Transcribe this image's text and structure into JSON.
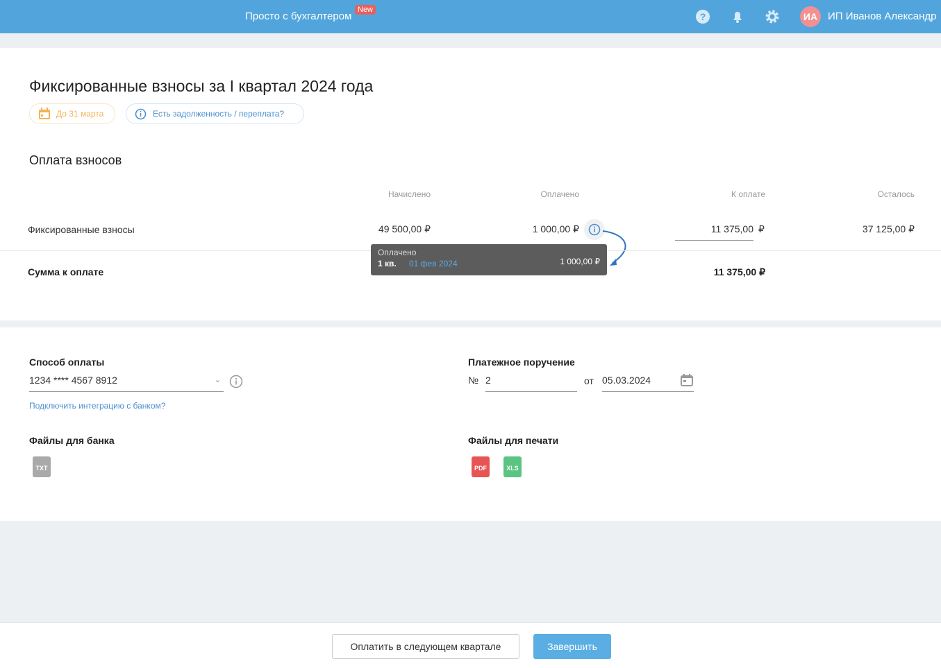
{
  "header": {
    "brand": "Просто с бухгалтером",
    "new_badge": "New",
    "avatar_initials": "ИА",
    "user_name": "ИП Иванов Александр"
  },
  "page": {
    "title": "Фиксированные взносы за I квартал 2024 года",
    "deadline": "До 31 марта",
    "debt_link": "Есть задолженность / переплата?"
  },
  "payment": {
    "section_title": "Оплата взносов",
    "columns": [
      "Начислено",
      "Оплачено",
      "К оплате",
      "Осталось"
    ],
    "row": {
      "label": "Фиксированные взносы",
      "accrued": "49 500,00 ₽",
      "paid": "1 000,00 ₽",
      "to_pay": "11 375,00",
      "currency": "₽",
      "remaining": "37 125,00 ₽"
    },
    "total_label": "Сумма к оплате",
    "total_value": "11 375,00 ₽"
  },
  "tooltip": {
    "title": "Оплачено",
    "quarter": "1 кв.",
    "date": "01 фев 2024",
    "amount": "1 000,00 ₽"
  },
  "form": {
    "method_label": "Способ оплаты",
    "method_value": "1234 **** 4567 8912",
    "bank_link": "Подключить интеграцию с банком?",
    "order_label": "Платежное поручение",
    "number_prefix": "№",
    "number": "2",
    "from_label": "от",
    "date": "05.03.2024",
    "bank_files_label": "Файлы для банка",
    "print_files_label": "Файлы для печати",
    "files": {
      "txt": "TXT",
      "pdf": "PDF",
      "xls": "XLS"
    }
  },
  "footer": {
    "next_quarter": "Оплатить в следующем квартале",
    "finish": "Завершить"
  }
}
